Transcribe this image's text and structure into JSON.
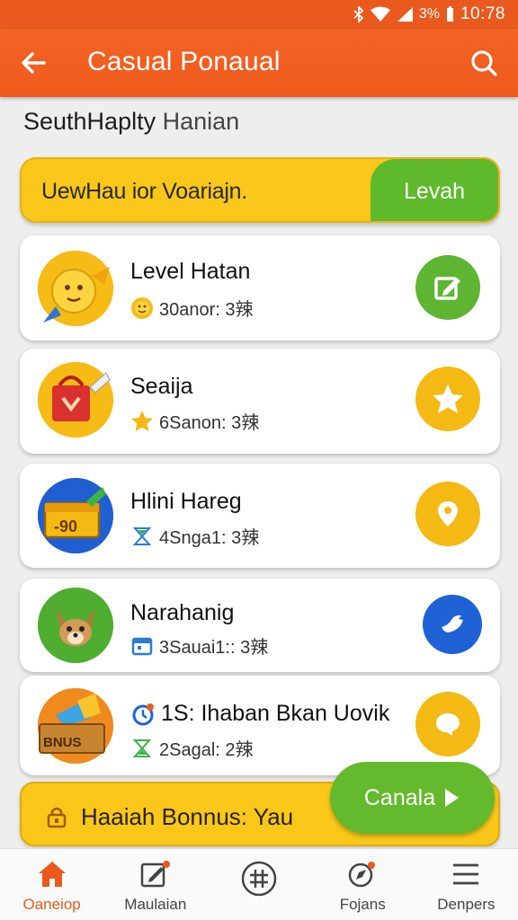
{
  "status_bar": {
    "battery": "3%",
    "time": "10:78"
  },
  "header": {
    "title": "Casual Ponaual",
    "back_icon": "arrow-left-icon",
    "search_icon": "search-icon"
  },
  "section": {
    "heading_main": "SeuthHaplty",
    "heading_sub": "Hanian"
  },
  "promo": {
    "text": "UewHau ior Voariajn.",
    "cta": "Levah"
  },
  "quests": [
    {
      "title": "Level Hatan",
      "meta": "30anor: 3辣",
      "thumb_icon": "candy-icon",
      "meta_icon": "coin-icon",
      "action_icon": "edit-icon",
      "action_color": "#5db531"
    },
    {
      "title": "Seaija",
      "meta": "6Sanon: 3辣",
      "thumb_icon": "gift-bag-icon",
      "meta_icon": "star-icon",
      "action_icon": "star-icon",
      "action_color": "#f5b914"
    },
    {
      "title": "Hlini Hareg",
      "meta": "4Snga1: 3辣",
      "thumb_icon": "treasure-box-icon",
      "meta_icon": "hourglass-icon",
      "action_icon": "location-pin-icon",
      "action_color": "#f5b914"
    },
    {
      "title": "Narahanig",
      "meta": "3Sauai1:: 3辣",
      "thumb_icon": "fox-icon",
      "meta_icon": "calendar-icon",
      "action_icon": "bird-icon",
      "action_color": "#1e62d6"
    },
    {
      "title": "1S: Ihaban Bkan Uovik",
      "meta": "2Sagal: 2辣",
      "thumb_icon": "gift-crate-icon",
      "meta_icon": "hourglass-icon",
      "action_icon": "chat-icon",
      "action_color": "#f5b914",
      "thumb_label": "BNUS",
      "title_icon": "timer-icon"
    }
  ],
  "bonus": {
    "text": "Haaiah Bonnus: Yau",
    "icon": "lock-icon"
  },
  "claim": {
    "label": "Canala",
    "icon": "play-arrow-icon"
  },
  "nav": [
    {
      "label": "Oaneiop",
      "icon": "home-icon",
      "active": true
    },
    {
      "label": "Maulaian",
      "icon": "edit-note-icon",
      "active": false
    },
    {
      "label": "",
      "icon": "grid-circle-icon",
      "active": false
    },
    {
      "label": "Fojans",
      "icon": "compass-icon",
      "active": false
    },
    {
      "label": "Denpers",
      "icon": "menu-icon",
      "active": false
    }
  ],
  "colors": {
    "primary": "#ef5b1d",
    "accent_yellow": "#f8c71a",
    "accent_green": "#63ba2c",
    "accent_blue": "#1e62d6"
  }
}
